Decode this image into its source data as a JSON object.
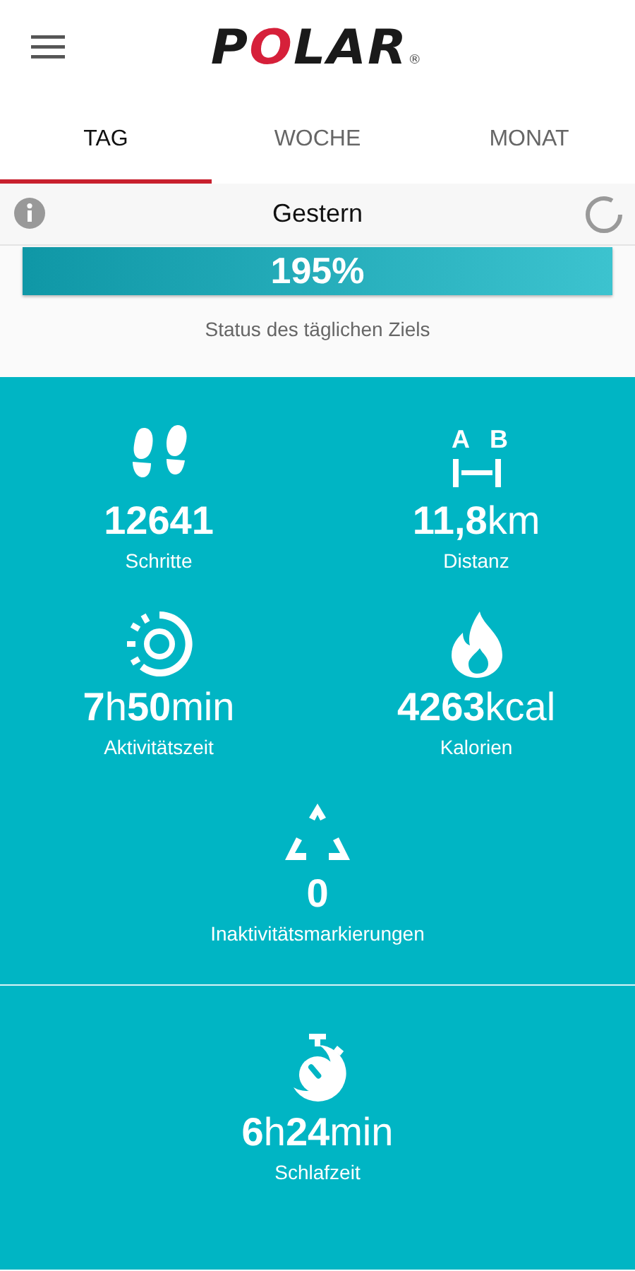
{
  "header": {
    "logo": {
      "text": "POLAR",
      "mark": "®"
    }
  },
  "tabs": [
    {
      "label": "TAG",
      "selected": true
    },
    {
      "label": "WOCHE",
      "selected": false
    },
    {
      "label": "MONAT",
      "selected": false
    }
  ],
  "day_bar": {
    "title": "Gestern"
  },
  "goal": {
    "level": 1,
    "reading": "195%",
    "caption": "Status des täglichen Ziels"
  },
  "stats": [
    {
      "kind": "steps",
      "value": "12641",
      "label": "Schritte"
    },
    {
      "kind": "distance",
      "icon_labels": [
        "A",
        "B"
      ],
      "value": "**11,8**km",
      "label": "Distanz"
    },
    {
      "kind": "active",
      "value": "**7**h**50**min",
      "label": "Aktivitätszeit"
    },
    {
      "kind": "calories",
      "value": "**4263**kcal",
      "label": "Kalorien"
    },
    {
      "kind": "inactivity",
      "value": "0",
      "label": "Inaktivitätsmarkierungen"
    }
  ],
  "sleep": {
    "kind": "sleep",
    "value": "**6**h**24**min",
    "label": "Schlafzeit"
  }
}
